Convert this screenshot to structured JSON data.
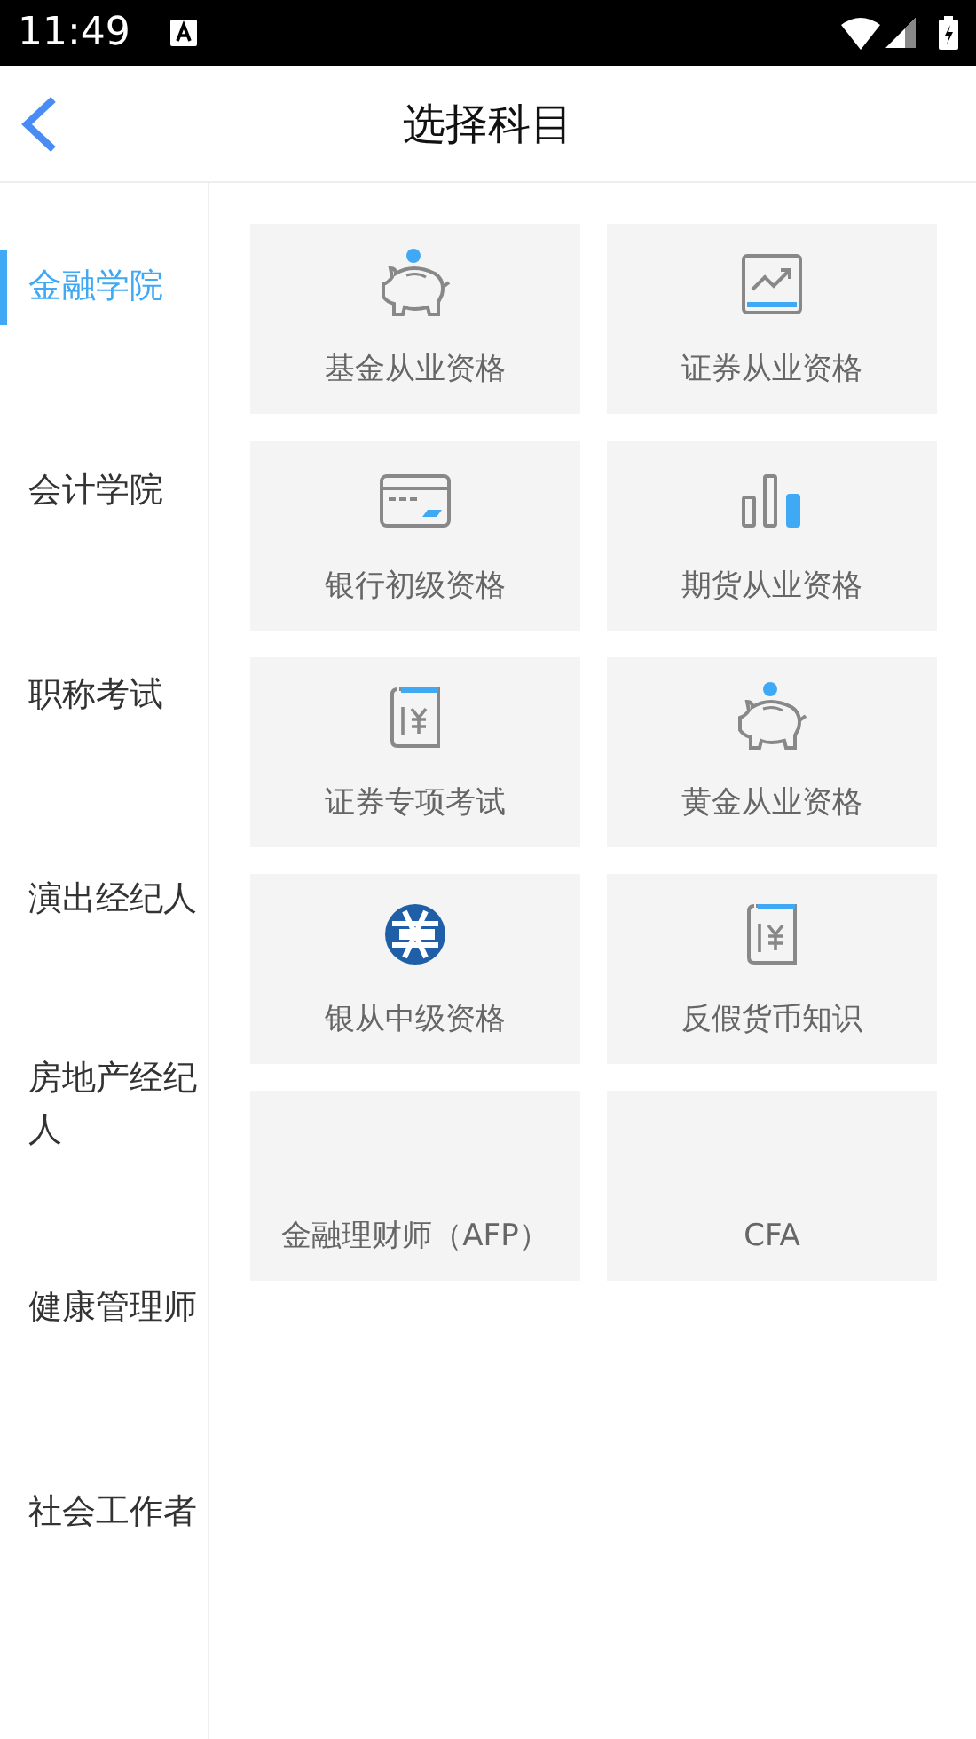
{
  "status_bar": {
    "time": "11:49"
  },
  "header": {
    "title": "选择科目"
  },
  "sidebar": {
    "items": [
      {
        "label": "金融学院",
        "selected": true
      },
      {
        "label": "会计学院",
        "selected": false
      },
      {
        "label": "职称考试",
        "selected": false
      },
      {
        "label": "演出经纪人",
        "selected": false
      },
      {
        "label": "房地产经纪人",
        "selected": false
      },
      {
        "label": "健康管理师",
        "selected": false
      },
      {
        "label": "社会工作者",
        "selected": false
      }
    ]
  },
  "subjects": [
    {
      "label": "基金从业资格",
      "kind": "piggy"
    },
    {
      "label": "证券从业资格",
      "kind": "chart"
    },
    {
      "label": "银行初级资格",
      "kind": "card"
    },
    {
      "label": "期货从业资格",
      "kind": "bars"
    },
    {
      "label": "证券专项考试",
      "kind": "book"
    },
    {
      "label": "黄金从业资格",
      "kind": "piggy"
    },
    {
      "label": "银从中级资格",
      "kind": "emblem"
    },
    {
      "label": "反假货币知识",
      "kind": "book"
    },
    {
      "label": "金融理财师（AFP）",
      "kind": "plain"
    },
    {
      "label": "CFA",
      "kind": "plain"
    }
  ]
}
